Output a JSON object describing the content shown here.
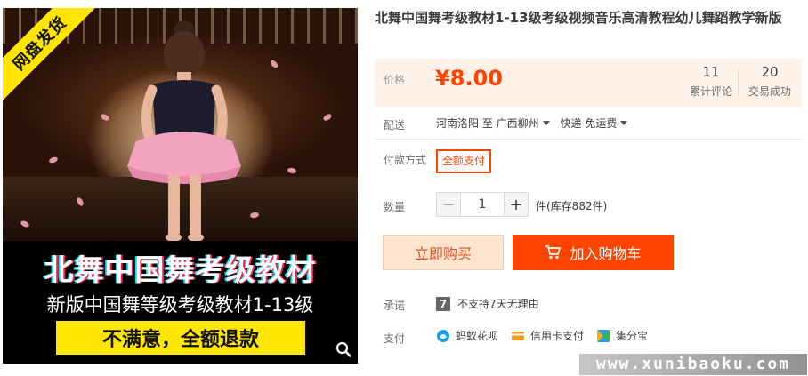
{
  "product_image": {
    "ribbon": "网盘发货",
    "banner_title": "北舞中国舞考级教材",
    "banner_subtitle": "新版中国舞等级考级教材1-13级",
    "banner_slogan": "不满意，全额退款",
    "search_icon": "search-icon"
  },
  "product": {
    "title": "北舞中国舞考级教材1-13级考级视频音乐高清教程幼儿舞蹈教学新版"
  },
  "price": {
    "label": "价格",
    "currency": "¥",
    "value": "8.00",
    "reviews_count": "11",
    "reviews_label": "累计评论",
    "trades_count": "20",
    "trades_label": "交易成功",
    "color": "#ff4400"
  },
  "shipping": {
    "label": "配送",
    "from": "河南洛阳 至",
    "to": "广西柳州",
    "method": "快递 免运费"
  },
  "payment_method": {
    "label": "付款方式",
    "option": "全额支付"
  },
  "quantity": {
    "label": "数量",
    "value": "1",
    "minus": "−",
    "plus": "+",
    "stock": "件(库存882件)"
  },
  "actions": {
    "buy_now": "立即购买",
    "add_to_cart": "加入购物车"
  },
  "promise": {
    "label": "承诺",
    "icon_text": "7",
    "text": "不支持7天无理由"
  },
  "pay": {
    "label": "支付",
    "options": [
      {
        "icon": "huabei-icon",
        "label": "蚂蚁花呗"
      },
      {
        "icon": "credit-card-icon",
        "label": "信用卡支付"
      },
      {
        "icon": "jifenbao-icon",
        "label": "集分宝"
      }
    ]
  },
  "watermark": "www.xunibaoku.com"
}
